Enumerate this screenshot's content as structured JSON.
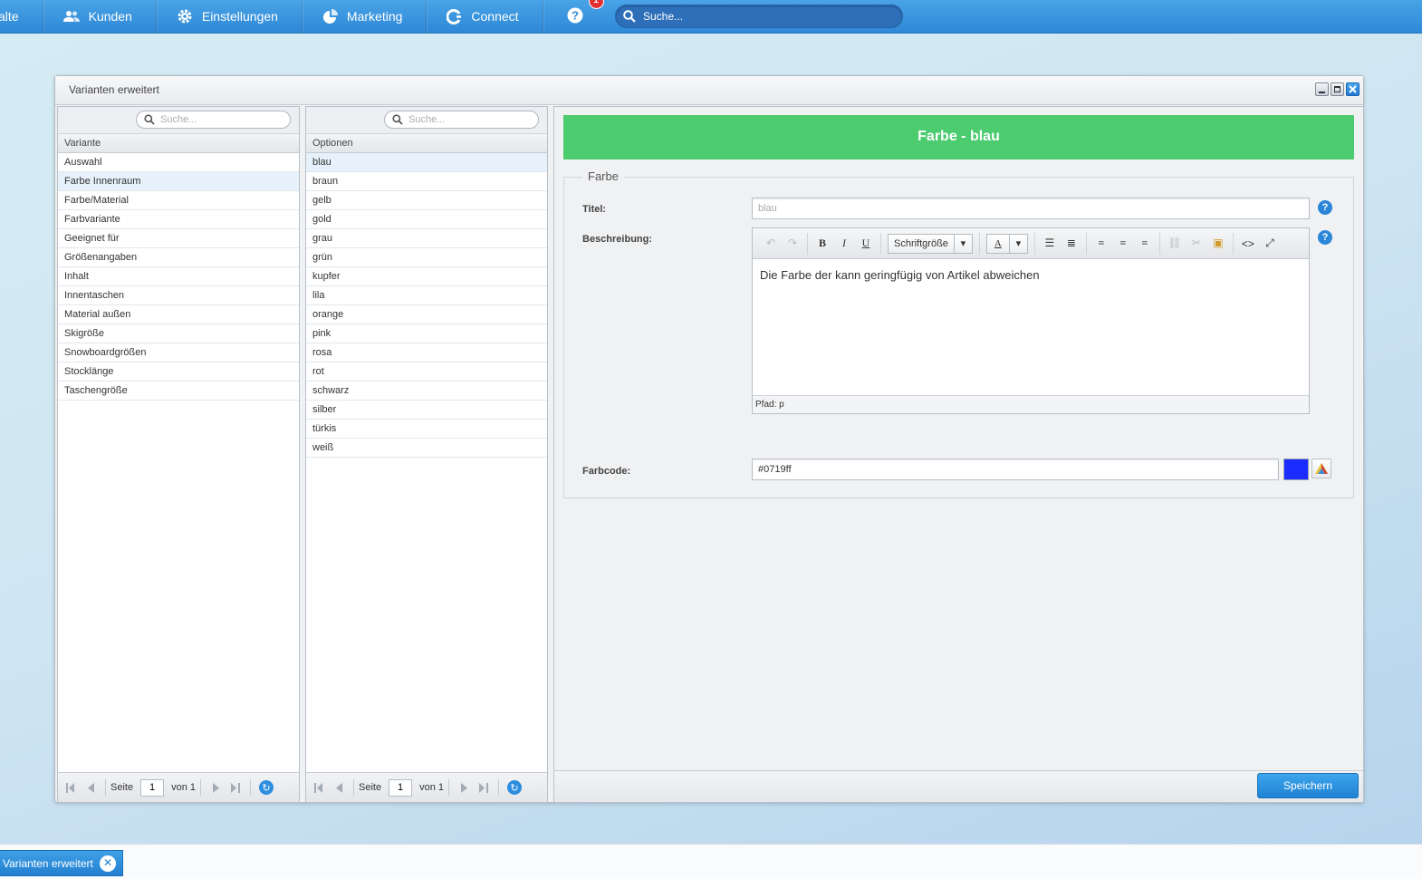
{
  "topnav": {
    "items": [
      {
        "label": "alte",
        "icon": "none"
      },
      {
        "label": "Kunden",
        "icon": "users-icon"
      },
      {
        "label": "Einstellungen",
        "icon": "gear-icon"
      },
      {
        "label": "Marketing",
        "icon": "pie-chart-icon"
      },
      {
        "label": "Connect",
        "icon": "connect-icon"
      }
    ],
    "help_badge": "1",
    "search_placeholder": "Suche..."
  },
  "window": {
    "title": "Varianten erweitert"
  },
  "variants_grid": {
    "search_placeholder": "Suche...",
    "header": "Variante",
    "rows": [
      "Auswahl",
      "Farbe Innenraum",
      "Farbe/Material",
      "Farbvariante",
      "Geeignet für",
      "Größenangaben",
      "Inhalt",
      "Innentaschen",
      "Material außen",
      "Skigröße",
      "Snowboardgrößen",
      "Stocklänge",
      "Taschengröße"
    ],
    "selected_index": 1,
    "pager": {
      "page_label": "Seite",
      "page": "1",
      "of_label": "von 1"
    }
  },
  "options_grid": {
    "search_placeholder": "Suche...",
    "header": "Optionen",
    "rows": [
      "blau",
      "braun",
      "gelb",
      "gold",
      "grau",
      "grün",
      "kupfer",
      "lila",
      "orange",
      "pink",
      "rosa",
      "rot",
      "schwarz",
      "silber",
      "türkis",
      "weiß"
    ],
    "selected_index": 0,
    "pager": {
      "page_label": "Seite",
      "page": "1",
      "of_label": "von 1"
    }
  },
  "detail": {
    "heading": "Farbe - blau",
    "heading_color": "#4ccb6f",
    "legend": "Farbe",
    "title_label": "Titel:",
    "title_placeholder": "blau",
    "description_label": "Beschreibung:",
    "font_size_select": "Schriftgröße",
    "description_text": "Die Farbe der kann geringfügig von Artikel abweichen",
    "status_path": "Pfad: p",
    "color_label": "Farbcode:",
    "color_value": "#0719ff",
    "swatch_color": "#1a2cff",
    "save_label": "Speichern"
  },
  "taskbar": {
    "item_label": "Varianten erweitert"
  }
}
